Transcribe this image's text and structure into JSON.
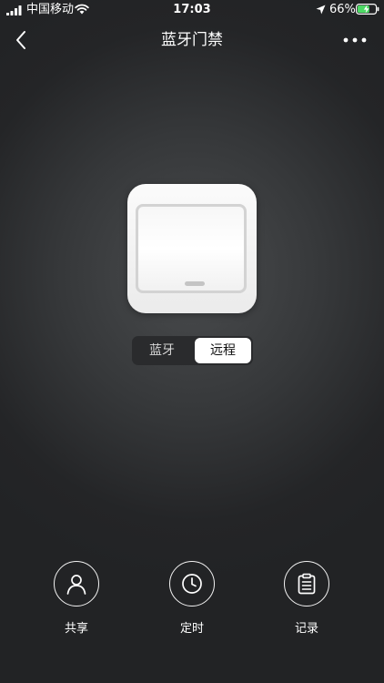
{
  "status_bar": {
    "carrier": "中国移动",
    "time": "17:03",
    "battery_percent": "66%",
    "battery_level": 0.66,
    "icons": [
      "signal-icon",
      "wifi-icon",
      "location-arrow-icon",
      "battery-charging-icon"
    ]
  },
  "nav": {
    "title": "蓝牙门禁",
    "back_icon": "chevron-left-icon",
    "more_icon": "more-dots-icon"
  },
  "switch": {
    "icon": "wall-switch-icon"
  },
  "mode_selector": {
    "options": [
      "蓝牙",
      "远程"
    ],
    "selected": "远程"
  },
  "actions": [
    {
      "label": "共享",
      "icon": "user-icon"
    },
    {
      "label": "定时",
      "icon": "clock-icon"
    },
    {
      "label": "记录",
      "icon": "clipboard-list-icon"
    }
  ],
  "colors": {
    "background": "#2b2c2e",
    "text": "#ffffff",
    "switch_face": "#f5f5f5",
    "segment_selected": "#ffffff"
  }
}
